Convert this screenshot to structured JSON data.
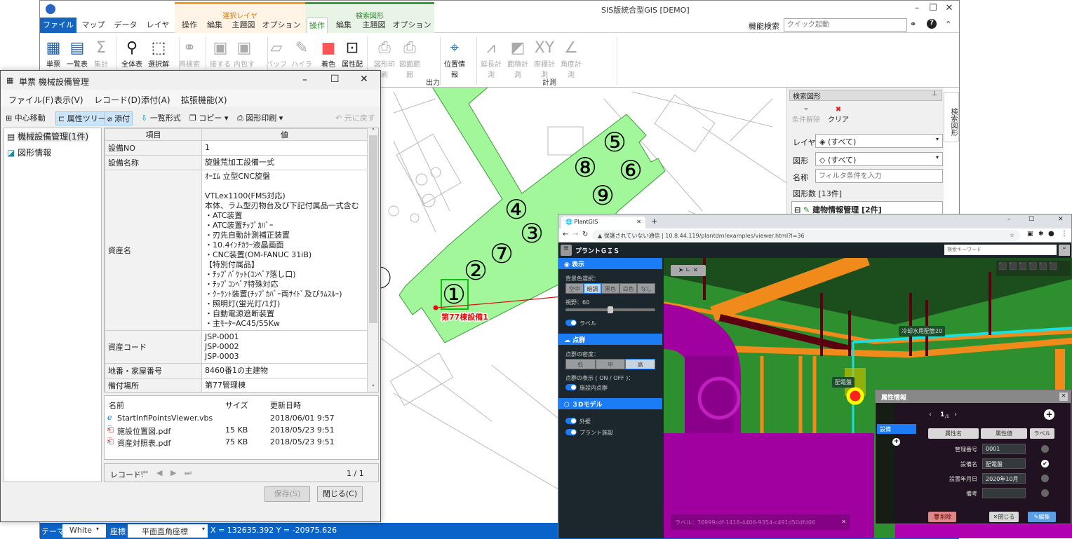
{
  "app": {
    "title": "SIS版統合型GIS [DEMO]",
    "search_label": "機能検索",
    "search_placeholder": "クイック起動"
  },
  "tabs": {
    "file": "ファイル",
    "map": "マップ",
    "data": "データ",
    "layer": "レイヤ",
    "ctx1": {
      "title": "選択レイヤ",
      "items": [
        "操作",
        "編集",
        "主題図",
        "オプション"
      ]
    },
    "ctx2": {
      "title": "検索図形",
      "items": [
        "操作",
        "編集",
        "主題図",
        "オプション"
      ]
    }
  },
  "ribbon": {
    "buttons": [
      "単票",
      "一覧表",
      "集計",
      "全体表示",
      "選択解除",
      "再検索",
      "接する",
      "内包する",
      "バッファ",
      "ハイライト",
      "着色",
      "属性配置",
      "図形印刷",
      "図面範囲",
      "位置情報",
      "延長計測",
      "面積計測",
      "座標計測",
      "角度計測"
    ],
    "groups": {
      "output": "出力",
      "measure": "計測"
    }
  },
  "map": {
    "labels": [
      "①",
      "②",
      "③",
      "④",
      "⑤",
      "⑥",
      "⑦",
      "⑧",
      "⑨"
    ],
    "callout": "第77棟設備1",
    "highlight_color": "#a3f79b"
  },
  "status": {
    "theme_label": "テーマ",
    "theme_value": "White",
    "coord_label": "座標",
    "coord_value": "平面直角座標",
    "xy": "X = 132635.392 Y = -20975.626"
  },
  "search_panel": {
    "title": "検索図形",
    "clear_cond": "条件解除",
    "clear": "クリア",
    "layer_label": "レイヤ",
    "layer_value": "(すべて)",
    "shape_label": "図形",
    "shape_value": "(すべて)",
    "name_label": "名称",
    "name_placeholder": "フィルタ条件を入力",
    "count": "図形数 [13件]",
    "tree_item": "建物情報管理 [2件]",
    "side_tab": "検索図形"
  },
  "dialog": {
    "title": "単票 機械設備管理",
    "menu": [
      "ファイル(F)",
      "表示(V)",
      "レコード(D)",
      "添付(A)",
      "拡張機能(X)"
    ],
    "toolbar": {
      "center": "中心移動",
      "tree": "属性ツリー",
      "attach": "添付",
      "list": "一覧形式",
      "copy": "コピー",
      "print": "図形印刷",
      "undo": "元に戻す"
    },
    "tree": [
      "機械設備管理(1件)",
      "図形情報"
    ],
    "table_headers": [
      "項目",
      "値"
    ],
    "rows": [
      {
        "k": "設備NO",
        "v": "1"
      },
      {
        "k": "設備名称",
        "v": "旋盤荒加工設備一式"
      },
      {
        "k": "資産名",
        "v": "ｵｰｴﾑ  立型CNC旋盤\n\nVTLex1100(FMS対応)\n本体、ラム型刃物台及び下記付属品一式含む\n・ATC装置\n・ATC装置ﾁｯﾌﾟｶﾊﾞｰ\n・刃先自動計測補正装置\n・10.4ｲﾝﾁｶﾗｰ液晶画面\n・CNC装置(OM-FANUC 31iB)\n【特別付属品】\n・ﾁｯﾌﾟﾊﾞｹｯﾄ(ｺﾝﾍﾞｱ落し口)\n・ﾁｯﾌﾟｺﾝﾍﾞｱ特殊対応\n・ｸｰﾗﾝﾄ装置(ﾁｯﾌﾟｶﾊﾞｰ両ｻｲﾄﾞ及びﾗﾑｽﾙｰ)\n・照明灯(蛍光灯/1灯)\n・自動電源遮断装置\n・主ﾓｰﾀｰAC45/55Kw"
      },
      {
        "k": "資産コード",
        "v": "JSP-0001\nJSP-0002\nJSP-0003"
      },
      {
        "k": "地番・家屋番号",
        "v": "8460番1の主建物"
      },
      {
        "k": "備付場所",
        "v": "第77管理棟"
      }
    ],
    "file_headers": [
      "名前",
      "サイズ",
      "更新日時"
    ],
    "files": [
      {
        "name": "StartInfiPointsViewer.vbs",
        "size": "",
        "date": "2018/06/01 9:57",
        "icon": "script-icon"
      },
      {
        "name": "施設位置図.pdf",
        "size": "15 KB",
        "date": "2018/05/23 9:51",
        "icon": "pdf-icon"
      },
      {
        "name": "資産対照表.pdf",
        "size": "75 KB",
        "date": "2018/05/23 9:51",
        "icon": "pdf-icon"
      }
    ],
    "record_label": "レコード:",
    "record_pos": "1 / 1",
    "save": "保存(S)",
    "close": "閉じる(C)"
  },
  "browser": {
    "tab": "PlantGIS",
    "url_warning": "保護されていない通信",
    "url": "10.8.44.119/plantdm/examples/viewer.html?l=36",
    "app_title": "プラントＧＩＳ",
    "search_placeholder": "検索キーワード",
    "side": {
      "display": "表示",
      "bg_label": "背景色選択：",
      "bg_opts": [
        "空中",
        "暗調",
        "黒色",
        "白色",
        "なし"
      ],
      "bg_selected": "暗調",
      "fov_label": "視野：60",
      "fov": 60,
      "label_toggle": "ラベル",
      "pc": "点群",
      "density_label": "点群の密度：",
      "density_opts": [
        "低",
        "中",
        "高"
      ],
      "density_selected": "高",
      "pc_show": "点群の表示 ( ON / OFF )：",
      "pc_toggle": "施設内点群",
      "model": "３Dモデル",
      "wall": "外壁",
      "plant": "プラント施設"
    },
    "scene_labels": {
      "pipe": "冷却水用配管20",
      "panel": "配電盤"
    },
    "label_bar": "ラベル：76999cdf-1418-4406-9354-c491d50dfd06",
    "attr": {
      "title": "属性情報",
      "page": "1",
      "total": "/1",
      "cat": "設備",
      "h_name": "属性名",
      "h_value": "属性値",
      "h_label": "ラベル",
      "rows": [
        {
          "k": "管理番号",
          "v": "0001",
          "label": false
        },
        {
          "k": "設備名",
          "v": "配電盤",
          "label": true
        },
        {
          "k": "設置年月日",
          "v": "2020年10月",
          "label": false
        },
        {
          "k": "備考",
          "v": "",
          "label": false
        }
      ],
      "delete": "削除",
      "close": "閉じる",
      "edit": "編集"
    }
  }
}
